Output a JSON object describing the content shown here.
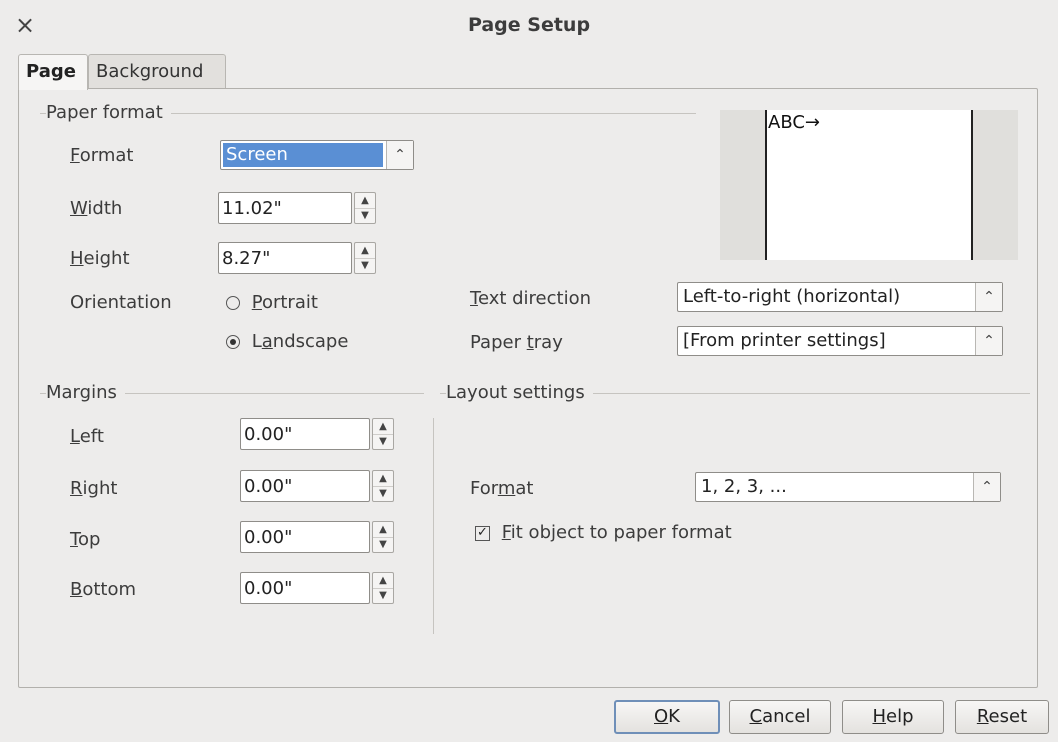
{
  "window": {
    "title": "Page Setup",
    "close_glyph": "×"
  },
  "tabs": [
    {
      "label": "Page",
      "active": true
    },
    {
      "label": "Background",
      "active": false
    }
  ],
  "paper_format": {
    "section_title": "Paper format",
    "format": {
      "label_pre": "",
      "label_u": "F",
      "label_post": "ormat",
      "value": "Screen"
    },
    "width": {
      "label_u": "W",
      "label_post": "idth",
      "value": "11.02\""
    },
    "height": {
      "label_u": "H",
      "label_post": "eight",
      "value": "8.27\""
    },
    "orientation": {
      "label": "Orientation",
      "portrait": {
        "label_u": "P",
        "label_post": "ortrait",
        "selected": false
      },
      "landscape": {
        "label_pre": "L",
        "label_u": "a",
        "label_post": "ndscape",
        "selected": true
      }
    },
    "text_direction": {
      "label_u": "T",
      "label_post": "ext direction",
      "value": "Left-to-right (horizontal)"
    },
    "paper_tray": {
      "label_pre": "Paper ",
      "label_u": "t",
      "label_post": "ray",
      "value": "[From printer settings]"
    }
  },
  "preview": {
    "text": "ABC→"
  },
  "margins": {
    "section_title": "Margins",
    "left": {
      "label_u": "L",
      "label_post": "eft",
      "value": "0.00\""
    },
    "right": {
      "label_u": "R",
      "label_post": "ight",
      "value": "0.00\""
    },
    "top": {
      "label_u": "T",
      "label_post": "op",
      "value": "0.00\""
    },
    "bottom": {
      "label_u": "B",
      "label_post": "ottom",
      "value": "0.00\""
    }
  },
  "layout_settings": {
    "section_title": "Layout settings",
    "format": {
      "label_pre": "For",
      "label_u": "m",
      "label_post": "at",
      "value": "1, 2, 3, ..."
    },
    "fit_object": {
      "label_u": "F",
      "label_post": "it object to paper format",
      "checked": true,
      "check_glyph": "✓"
    }
  },
  "buttons": {
    "ok": {
      "label_u": "O",
      "label_post": "K"
    },
    "cancel": {
      "label_u": "C",
      "label_post": "ancel"
    },
    "help": {
      "label_u": "H",
      "label_post": "elp"
    },
    "reset": {
      "label_u": "R",
      "label_post": "eset"
    }
  },
  "glyphs": {
    "combo_arrow": "⌃⌄",
    "spin_up": "▲",
    "spin_down": "▼"
  }
}
